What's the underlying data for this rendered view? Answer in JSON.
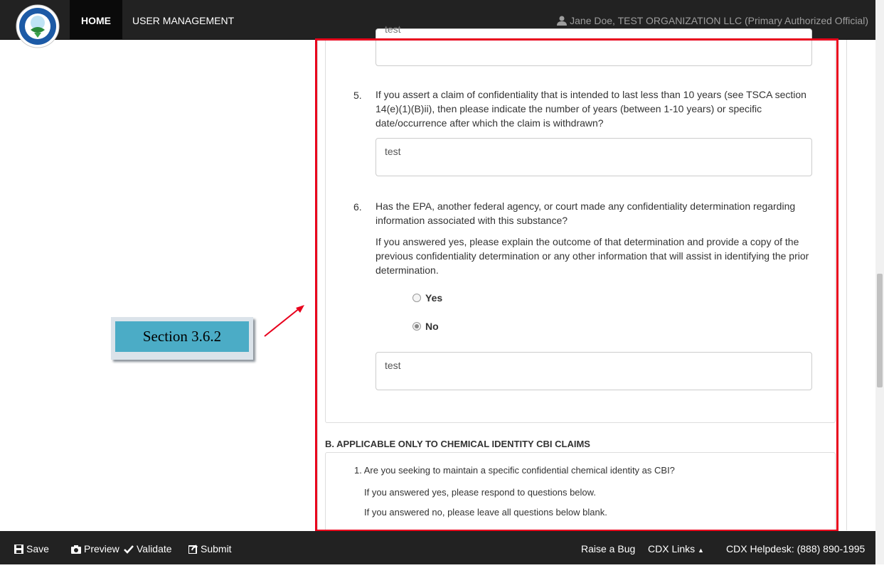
{
  "nav": {
    "home": "HOME",
    "user_management": "USER MANAGEMENT",
    "user_info": "Jane Doe, TEST ORGANIZATION LLC (Primary Authorized Official)",
    "user_icon": "user-icon",
    "logo_icon": "epa-seal-icon"
  },
  "form": {
    "prev_answer": "test",
    "q5": {
      "number": "5.",
      "text": "If you assert a claim of confidentiality that is intended to last less than 10 years (see TSCA section 14(e)(1)(B)ii), then please indicate the number of years (between 1-10 years) or specific date/occurrence after which the claim is withdrawn?",
      "answer": "test"
    },
    "q6": {
      "number": "6.",
      "text": "Has the EPA, another federal agency, or court made any confidentiality determination regarding information associated with this substance?",
      "subtext": "If you answered yes, please explain the outcome of that determination and provide a copy of the previous confidentiality determination or any other information that will assist in identifying the prior determination.",
      "option_yes": "Yes",
      "option_no": "No",
      "selected": "No",
      "answer": "test"
    },
    "section_b": {
      "title": "B. APPLICABLE ONLY TO CHEMICAL IDENTITY CBI CLAIMS",
      "q1": "1. Are you seeking to maintain a specific confidential chemical identity as CBI?",
      "line_yes": "If you answered yes, please respond to questions below.",
      "line_no": "If you answered no, please leave all questions below blank."
    }
  },
  "annotation": {
    "callout_label": "Section 3.6.2",
    "highlight_color": "#e8001c",
    "callout_color": "#4bacc6"
  },
  "footer": {
    "save": "Save",
    "preview": "Preview",
    "validate": "Validate",
    "submit": "Submit",
    "raise_bug": "Raise a Bug",
    "cdx_links": "CDX Links",
    "helpdesk": "CDX Helpdesk: (888) 890-1995"
  }
}
